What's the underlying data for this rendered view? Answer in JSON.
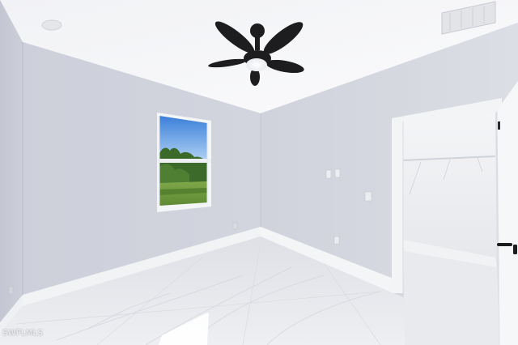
{
  "watermark": {
    "text": "SWFLMLS"
  },
  "colors": {
    "ceiling": "#f5f6f8",
    "left_wall": "#c9cbd8",
    "back_wall": "#d2d4de",
    "right_wall": "#d8dae2",
    "baseboard": "#f2f3f5",
    "floor": "#e6e7ec",
    "door_trim": "#f3f4f6",
    "fan": "#1d1d1f",
    "sky": "#4e8fe0",
    "foliage": "#3c6a2b"
  },
  "icons": {
    "fan": "ceiling-fan-icon",
    "light": "smoke-detector-icon",
    "vent": "air-vent-icon",
    "handle": "door-handle-icon"
  }
}
